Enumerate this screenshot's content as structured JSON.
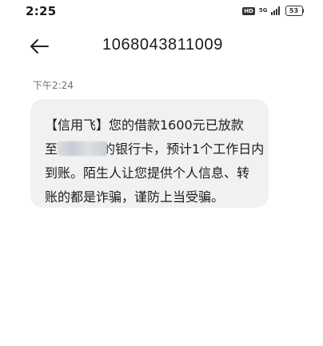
{
  "status_bar": {
    "time": "2:25",
    "hd_badge": "HD",
    "network": "5G",
    "battery": "53",
    "icons": [
      "hd-icon",
      "signal-icon",
      "battery-icon"
    ]
  },
  "header": {
    "back_icon": "arrow-left-icon",
    "title": "1068043811009"
  },
  "message": {
    "timestamp": "下午2:24",
    "line1": "【信用飞】您的借款1600元已放款",
    "line2_prefix": "至",
    "line2_redacted_note": "redacted",
    "line2_suffix": "的银行卡，预计1个工作日内",
    "line3": "到账。陌生人让您提供个人信息、转",
    "line4": "账的都是诈骗，谨防上当受骗。"
  },
  "colors": {
    "background": "#ffffff",
    "bubble": "#f1f1f1",
    "text": "#1c1c1c",
    "timestamp": "#6f6f6f"
  }
}
